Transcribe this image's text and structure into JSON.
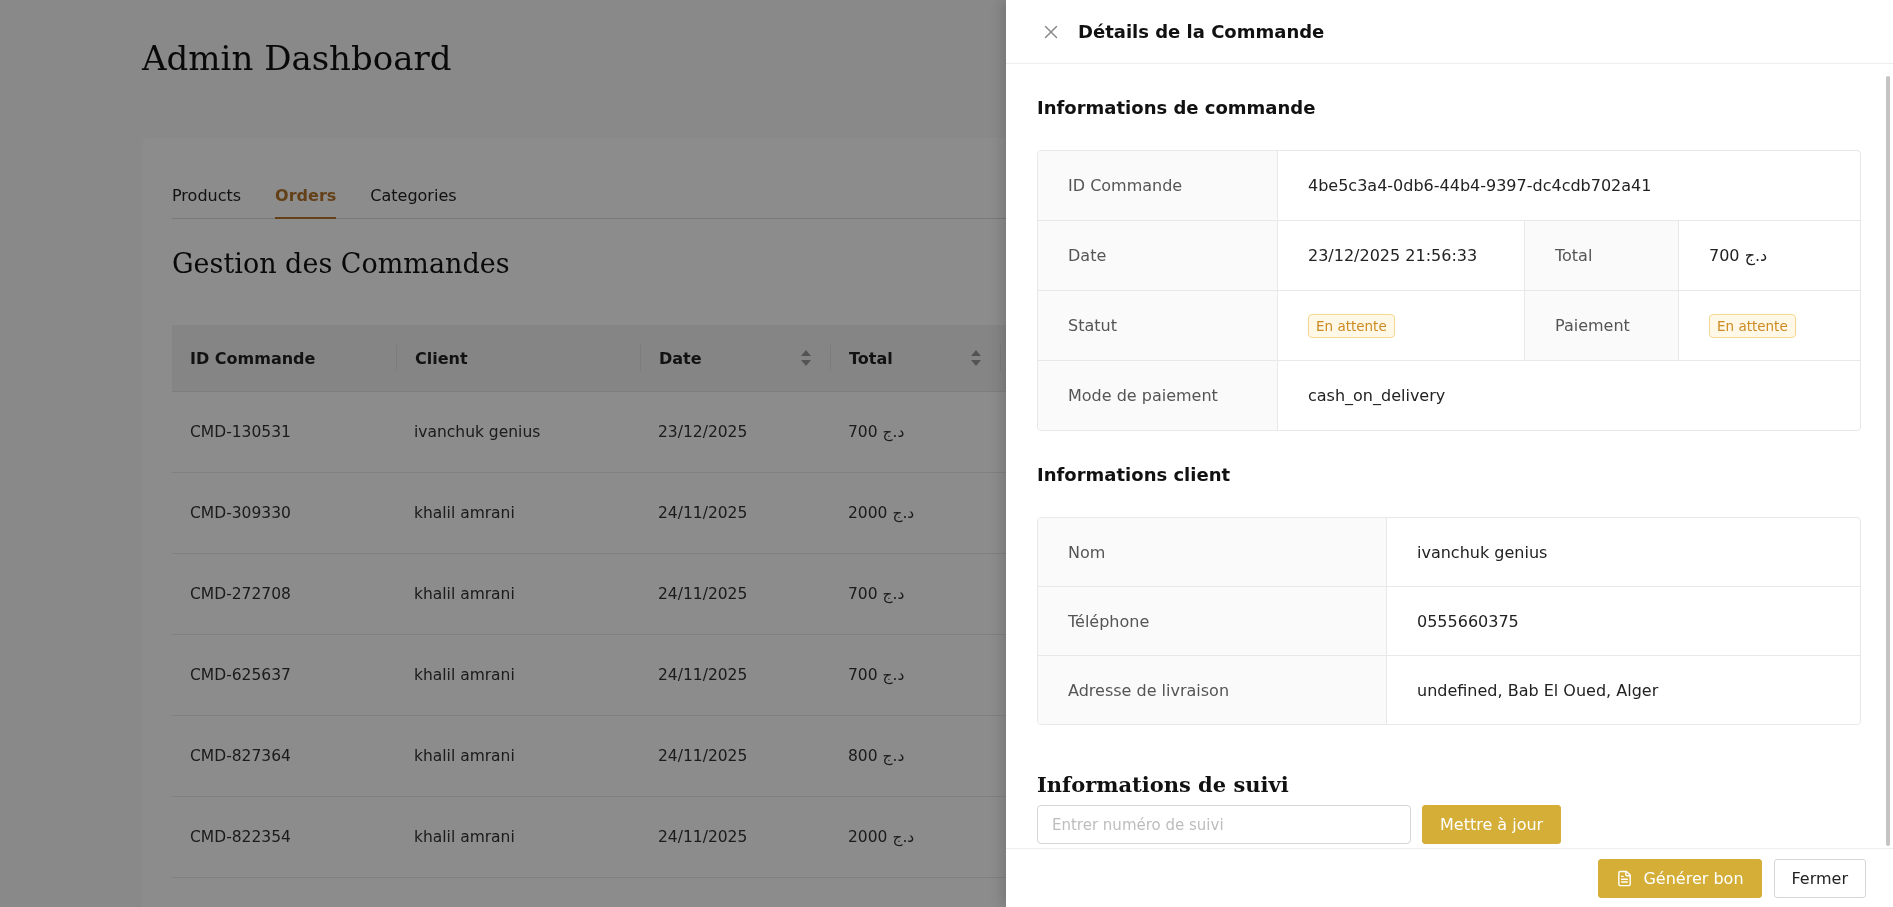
{
  "page": {
    "title": "Admin Dashboard"
  },
  "tabs": [
    {
      "label": "Products",
      "selected": false
    },
    {
      "label": "Orders",
      "selected": true
    },
    {
      "label": "Categories",
      "selected": false
    }
  ],
  "section_title": "Gestion des Commandes",
  "table": {
    "columns": [
      {
        "label": "ID Commande",
        "sortable": false
      },
      {
        "label": "Client",
        "sortable": false
      },
      {
        "label": "Date",
        "sortable": true
      },
      {
        "label": "Total",
        "sortable": true
      }
    ],
    "rows": [
      [
        "CMD-130531",
        "ivanchuk genius",
        "23/12/2025",
        "700 د.ج"
      ],
      [
        "CMD-309330",
        "khalil amrani",
        "24/11/2025",
        "2000 د.ج"
      ],
      [
        "CMD-272708",
        "khalil amrani",
        "24/11/2025",
        "700 د.ج"
      ],
      [
        "CMD-625637",
        "khalil amrani",
        "24/11/2025",
        "700 د.ج"
      ],
      [
        "CMD-827364",
        "khalil amrani",
        "24/11/2025",
        "800 د.ج"
      ],
      [
        "CMD-822354",
        "khalil amrani",
        "24/11/2025",
        "2000 د.ج"
      ]
    ]
  },
  "drawer": {
    "title": "Détails de la Commande",
    "order_info": {
      "heading": "Informations de commande",
      "rows": [
        {
          "fields": [
            {
              "label": "ID Commande",
              "value": "4be5c3a4-0db6-44b4-9397-dc4cdb702a41",
              "kind": "text"
            }
          ]
        },
        {
          "fields": [
            {
              "label": "Date",
              "value": "23/12/2025 21:56:33",
              "kind": "text"
            },
            {
              "label": "Total",
              "value": "700 د.ج",
              "kind": "text"
            }
          ]
        },
        {
          "fields": [
            {
              "label": "Statut",
              "value": "En attente",
              "kind": "badge"
            },
            {
              "label": "Paiement",
              "value": "En attente",
              "kind": "badge"
            }
          ]
        },
        {
          "fields": [
            {
              "label": "Mode de paiement",
              "value": "cash_on_delivery",
              "kind": "text"
            }
          ]
        }
      ]
    },
    "client_info": {
      "heading": "Informations client",
      "rows": [
        {
          "label": "Nom",
          "value": "ivanchuk genius"
        },
        {
          "label": "Téléphone",
          "value": "0555660375"
        },
        {
          "label": "Adresse de livraison",
          "value": "undefined, Bab El Oued, Alger"
        }
      ]
    },
    "tracking": {
      "heading": "Informations de suivi",
      "placeholder": "Entrer numéro de suivi",
      "button": "Mettre à jour"
    },
    "footer_buttons": [
      {
        "label": "Générer bon",
        "kind": "primary"
      },
      {
        "label": "Fermer",
        "kind": "secondary"
      }
    ]
  }
}
